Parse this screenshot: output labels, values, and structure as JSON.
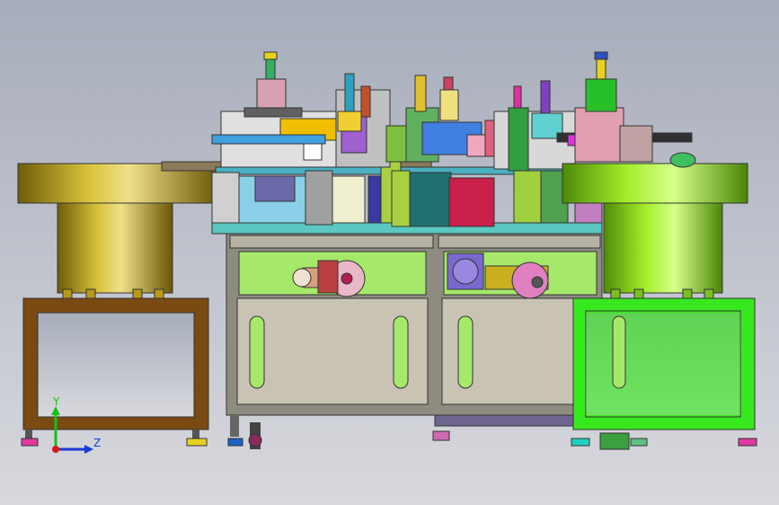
{
  "scene": {
    "description_visible_text": "",
    "background_top": "#a8aebb",
    "background_bottom": "#d6d7dc"
  },
  "colors": {
    "left_bowl_gold": "#c8ae20",
    "right_bowl_green": "#9ae01c",
    "left_stand_brown": "#7a4a12",
    "right_stand_green": "#38e81e",
    "cabinet_gray": "#8c8a7c",
    "cabinet_panel": "#c8c3b3",
    "window_green": "#a6e86a",
    "frame_outline": "#333333"
  },
  "axis_triad": {
    "y_label": "Y",
    "z_label": "Z",
    "y_color": "#18c018",
    "z_color": "#1a3cd8",
    "origin_color": "#d81818"
  },
  "icons": {
    "triad": "axis-triad-icon"
  }
}
